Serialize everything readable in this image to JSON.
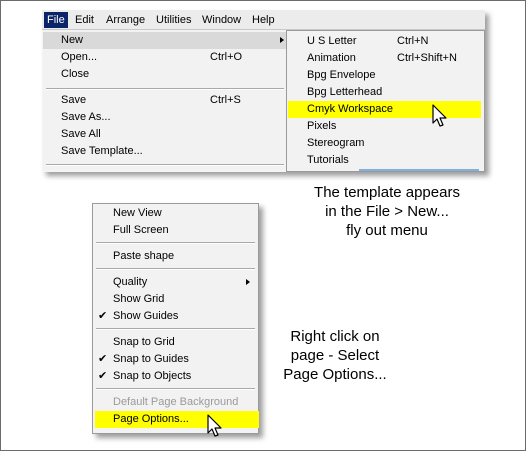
{
  "menubar": {
    "items": [
      "File",
      "Edit",
      "Arrange",
      "Utilities",
      "Window",
      "Help"
    ]
  },
  "file_menu": {
    "items": [
      {
        "label": "New",
        "shortcut": "",
        "submenu": true
      },
      {
        "label": "Open...",
        "shortcut": "Ctrl+O"
      },
      {
        "label": "Close",
        "shortcut": ""
      },
      {
        "label": "Save",
        "shortcut": "Ctrl+S"
      },
      {
        "label": "Save As...",
        "shortcut": ""
      },
      {
        "label": "Save All",
        "shortcut": ""
      },
      {
        "label": "Save Template...",
        "shortcut": ""
      }
    ]
  },
  "new_flyout": {
    "items": [
      {
        "label": "U S Letter",
        "shortcut": "Ctrl+N"
      },
      {
        "label": "Animation",
        "shortcut": "Ctrl+Shift+N"
      },
      {
        "label": "Bpg Envelope",
        "shortcut": ""
      },
      {
        "label": "Bpg Letterhead",
        "shortcut": ""
      },
      {
        "label": "Cmyk Workspace",
        "shortcut": "",
        "highlighted": true
      },
      {
        "label": "Pixels",
        "shortcut": ""
      },
      {
        "label": "Stereogram",
        "shortcut": ""
      },
      {
        "label": "Tutorials",
        "shortcut": ""
      }
    ]
  },
  "context_menu": {
    "items": [
      {
        "label": "New View"
      },
      {
        "label": "Full Screen"
      },
      {
        "label": "Paste shape"
      },
      {
        "label": "Quality",
        "submenu": true
      },
      {
        "label": "Show Grid"
      },
      {
        "label": "Show Guides",
        "checked": true
      },
      {
        "label": "Snap to Grid"
      },
      {
        "label": "Snap to Guides",
        "checked": true
      },
      {
        "label": "Snap to Objects",
        "checked": true
      },
      {
        "label": "Default Page Background",
        "disabled": true
      },
      {
        "label": "Page Options...",
        "highlighted": true
      }
    ]
  },
  "captions": {
    "top": [
      "The template appears",
      "in the File > New...",
      "fly out menu"
    ],
    "bottom": [
      "Right click on",
      "page - Select",
      "Page Options..."
    ]
  },
  "colors": {
    "highlight": "#ffff00",
    "menubar_active": "#0a246a",
    "menu_background": "#f2f2f2"
  },
  "icons": {
    "check": "checkmark-icon",
    "submenu": "submenu-arrow-icon",
    "pointer": "mouse-pointer-icon"
  }
}
